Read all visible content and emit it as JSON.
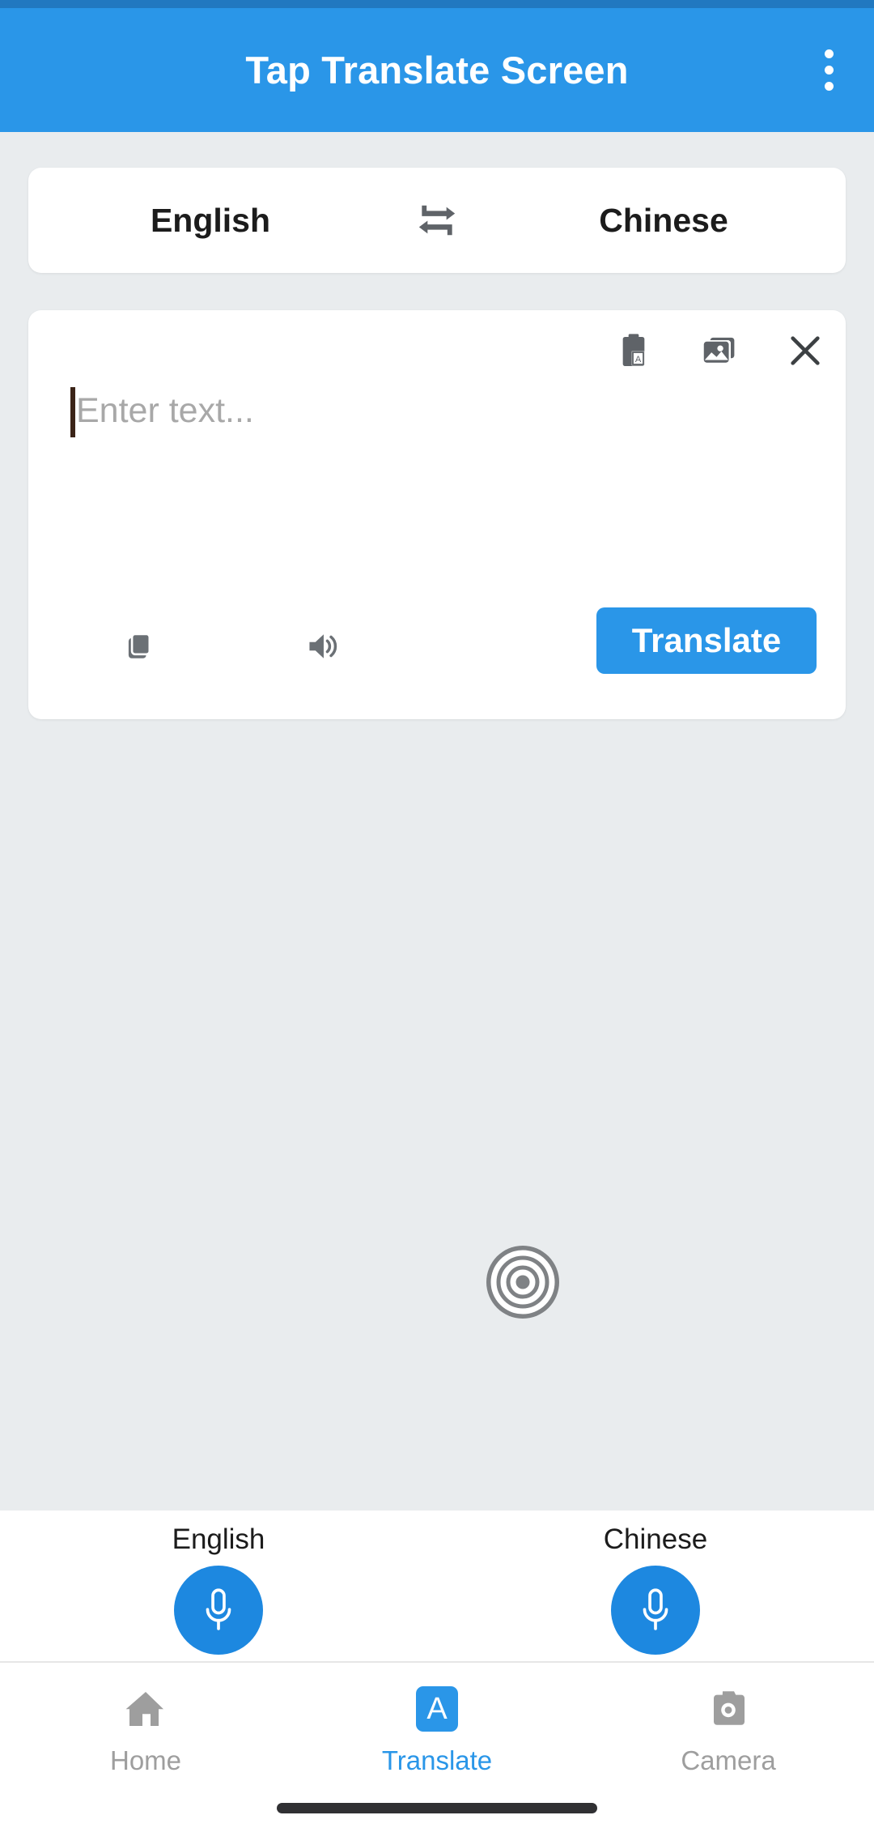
{
  "app_bar": {
    "title": "Tap Translate Screen",
    "overflow_icon": "more-vert-icon",
    "background_color": "#2a96e8",
    "status_bar_color": "#2178c0"
  },
  "language_selector": {
    "source_language": "English",
    "target_language": "Chinese",
    "swap_icon": "swap-horizontal-icon"
  },
  "input_card": {
    "placeholder": "Enter text...",
    "value": "",
    "top_actions": [
      {
        "icon": "paste-clipboard-icon"
      },
      {
        "icon": "image-gallery-icon"
      },
      {
        "icon": "close-icon"
      }
    ],
    "bottom_actions": [
      {
        "icon": "copy-icon"
      },
      {
        "icon": "speaker-icon"
      }
    ],
    "translate_button_label": "Translate",
    "translate_button_color": "#2a96e8"
  },
  "overlay": {
    "cursor_icon": "bullseye-target-icon"
  },
  "mic_section": {
    "buttons": [
      {
        "label": "English",
        "icon": "microphone-icon"
      },
      {
        "label": "Chinese",
        "icon": "microphone-icon"
      }
    ],
    "mic_button_color": "#1d88e0"
  },
  "bottom_nav": {
    "active_color": "#2a96e8",
    "inactive_color": "#9e9e9e",
    "items": [
      {
        "label": "Home",
        "icon": "home-icon",
        "active": false
      },
      {
        "label": "Translate",
        "icon": "letter-a-icon",
        "active": true
      },
      {
        "label": "Camera",
        "icon": "camera-icon",
        "active": false
      }
    ]
  }
}
